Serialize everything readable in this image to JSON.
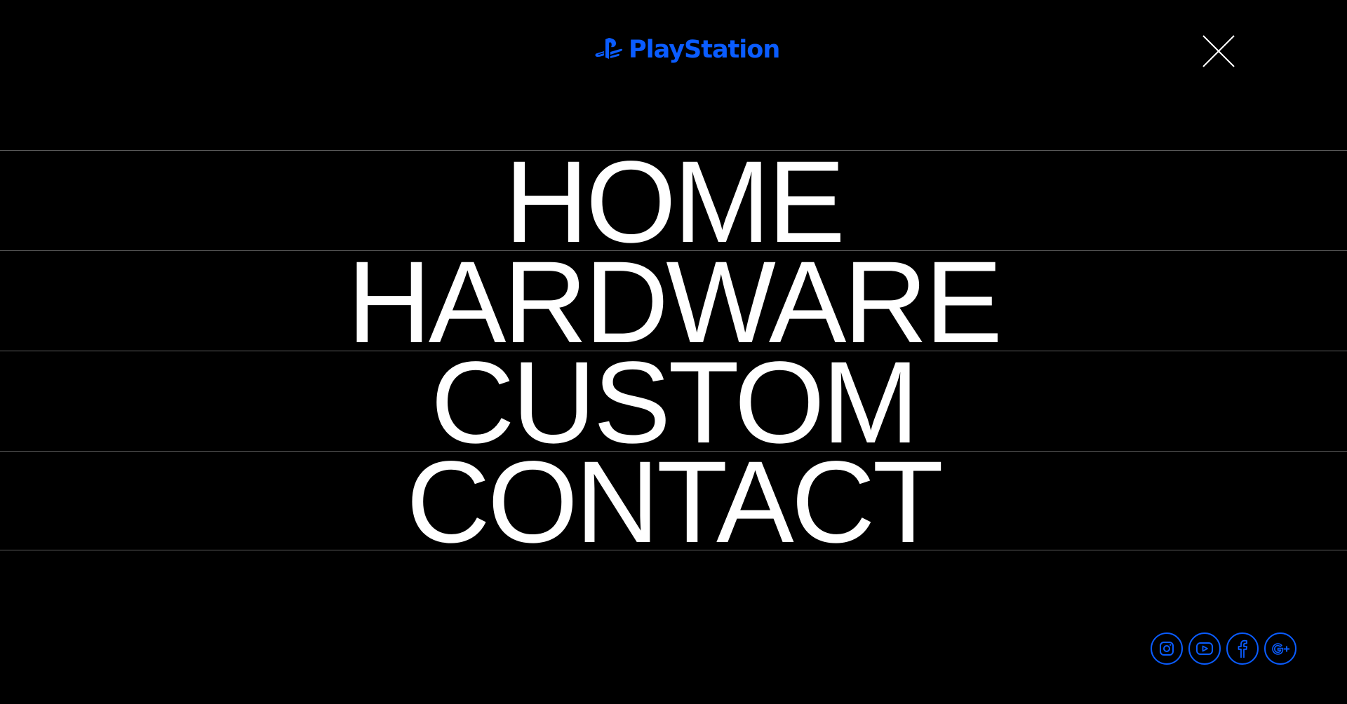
{
  "header": {
    "logo_text": "PlayStation",
    "logo_icon": "playstation-logo-icon",
    "close_icon": "close-icon"
  },
  "menu": {
    "items": [
      {
        "label": "HOME"
      },
      {
        "label": "HARDWARE"
      },
      {
        "label": "CUSTOM"
      },
      {
        "label": "CONTACT"
      }
    ]
  },
  "social": {
    "icons": [
      "instagram-icon",
      "youtube-icon",
      "facebook-icon",
      "google-plus-icon"
    ]
  },
  "colors": {
    "background": "#000000",
    "text": "#ffffff",
    "accent": "#0a5cff",
    "divider": "#5c5c5c"
  }
}
